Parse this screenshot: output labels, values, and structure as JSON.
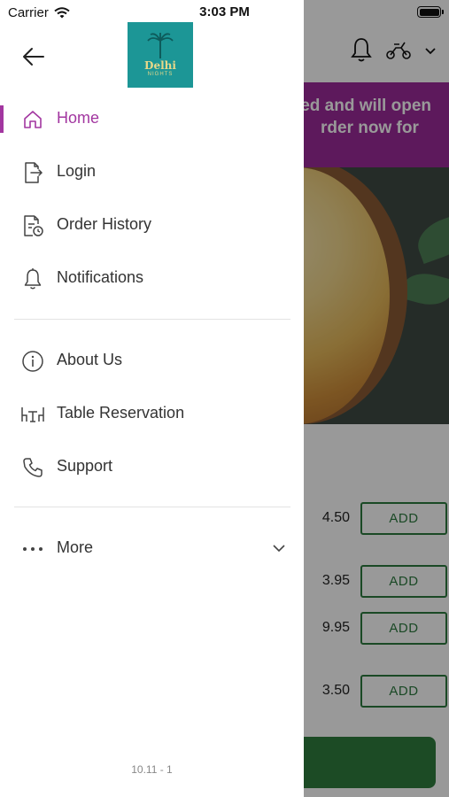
{
  "status_bar": {
    "carrier": "Carrier",
    "time": "3:03 PM"
  },
  "background": {
    "banner_line1": "ed and will open",
    "banner_line2": "rder now for",
    "rows": [
      {
        "price": "4.50",
        "add": "ADD"
      },
      {
        "price": "3.95",
        "add": "ADD"
      },
      {
        "price": "9.95",
        "add": "ADD"
      },
      {
        "price": "3.50",
        "add": "ADD"
      }
    ]
  },
  "drawer": {
    "logo_text": "Delhi",
    "logo_sub": "NIGHTS",
    "items": [
      {
        "label": "Home",
        "icon": "home-icon",
        "active": true
      },
      {
        "label": "Login",
        "icon": "login-icon"
      },
      {
        "label": "Order History",
        "icon": "order-history-icon"
      },
      {
        "label": "Notifications",
        "icon": "bell-icon"
      },
      {
        "label": "About Us",
        "icon": "info-icon"
      },
      {
        "label": "Table Reservation",
        "icon": "table-icon"
      },
      {
        "label": "Support",
        "icon": "phone-icon"
      }
    ],
    "more_label": "More",
    "version": "10.11 - 1"
  },
  "colors": {
    "accent": "#a236a0",
    "banner": "#9c2b9a",
    "green": "#2c7a3f",
    "logo_bg": "#1c9696"
  }
}
